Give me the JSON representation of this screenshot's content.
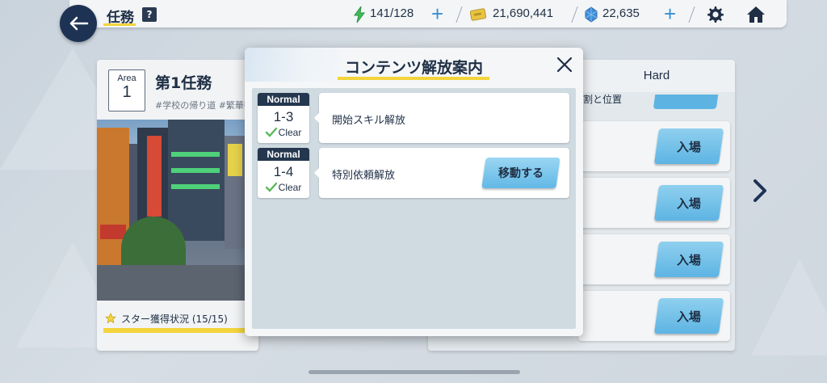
{
  "header": {
    "title": "任務",
    "help_label": "?",
    "stamina": "141/128",
    "credits": "21,690,441",
    "gems": "22,635"
  },
  "area": {
    "area_label": "Area",
    "area_number": "1",
    "title": "第1任務",
    "tags": "#学校の帰り道 #繁華街",
    "star_status": "スター獲得状況 (15/15)"
  },
  "right_panel": {
    "hard_tab": "Hard",
    "partial_text": "割と位置",
    "enter_buttons": [
      "入場",
      "入場",
      "入場",
      "入場"
    ]
  },
  "modal": {
    "title": "コンテンツ解放案内",
    "items": [
      {
        "difficulty": "Normal",
        "stage": "1-3",
        "status": "Clear",
        "text": "開始スキル解放",
        "button": ""
      },
      {
        "difficulty": "Normal",
        "stage": "1-4",
        "status": "Clear",
        "text": "特別依頼解放",
        "button": "移動する"
      }
    ]
  },
  "colors": {
    "navy": "#1e3354",
    "accent_yellow": "#f3d43c",
    "button_blue": "#5db4e3",
    "check_green": "#5cb85c"
  },
  "icons": [
    "back-arrow-icon",
    "help-icon",
    "stamina-bolt-icon",
    "credit-ticket-icon",
    "gem-icon",
    "gear-icon",
    "home-icon",
    "close-icon",
    "check-icon",
    "star-icon",
    "chevron-right-icon"
  ]
}
